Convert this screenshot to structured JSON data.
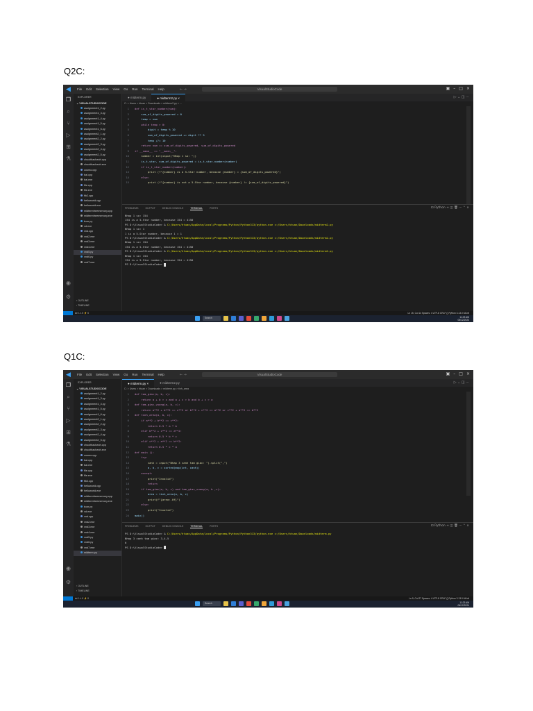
{
  "headings": {
    "q2": "Q2C:",
    "q1": "Q1C:"
  },
  "window": {
    "menus": [
      "File",
      "Edit",
      "Selection",
      "View",
      "Go",
      "Run",
      "Terminal",
      "Help"
    ],
    "search": "VisualStudioCode",
    "explorer_label": "EXPLORER",
    "folder": "VISUALSTUDIOCODE",
    "outline": "OUTLINE",
    "timeline": "TIMELINE",
    "panel_tabs": [
      "PROBLEMS",
      "OUTPUT",
      "DEBUG CONSOLE",
      "TERMINAL",
      "PORTS"
    ],
    "panel_right": "Python",
    "taskbar_search": "Search",
    "accent": "#0078d4"
  },
  "screenshot_q2": {
    "tabs": [
      "midterm.py",
      "midterm2.py"
    ],
    "active_tab": 1,
    "breadcrumb": "C: > Users > htuan > Downloads > midterm2.py > ...",
    "files": [
      "assignment1_2.py",
      "assignment1_3.py",
      "assignment1_4.py",
      "assignment1_5.py",
      "assignment1_6.py",
      "assignment2_1.py",
      "assignment2_2.py",
      "assignment2_3.py",
      "assignment2_4.py",
      "assignment2_5.py",
      "chuoithachanh.cpp",
      "chuoithachanh.exe",
      "cosmo.cpp",
      "bai.cpp",
      "bai.exe",
      "file.cpp",
      "file.exe",
      "fib2.cpp",
      "helloworld.cpp",
      "helloworld.exe",
      "midtermfreememory.cpp",
      "midtermfreememory.exe",
      "tcon.py",
      "vd.exe",
      "vnd.cpp",
      "vnd2.exe",
      "vnd3.exe",
      "vnd4.exe",
      "vnd5.py",
      "vnd6.py",
      "vnd7.exe"
    ],
    "active_file": 28,
    "code": [
      "def is_t_star_number(num):",
      "    sum_of_digits_powered = 0",
      "    temp = num",
      "    while temp > 0:",
      "        digit = temp % 10",
      "        sum_of_digits_powered += digit ** 5",
      "        temp //= 10",
      "    return num == sum_of_digits_powered, sum_of_digits_powered",
      "if __name__ == \"__main__\":",
      "    number = int(input(\"Nhap 1 so: \"))",
      "    is_t_star, sum_of_digits_powered = is_t_star_number(number)",
      "    if is_t_star_number(number):",
      "        print (f\"{number} is a 5-Star number, because {number} = {sum_of_digits_powered}\")",
      "    else:",
      "        print (f\"{number} is not a 5-Star number, because {number} != {sum_of_digits_powered}\")"
    ],
    "line_numbers": [
      "1",
      "2",
      "3",
      "4",
      "5",
      "6",
      "7",
      "8",
      "9",
      "10",
      "11",
      "12",
      "13",
      "14",
      "15"
    ],
    "terminal": [
      "Nhap 1 so: 154",
      "154 is a 5-Star number, because 154 = 4150",
      "PS D:\\VisualStudioCode> & C:/Users/htuan/AppData/Local/Programs/Python/Python313/python.exe c:/Users/htuan/Downloads/midterm2.py",
      "Nhap 1 so: 1",
      "1 is a 5-Star number, because 1 = 1",
      "PS D:\\VisualStudioCode> & C:/Users/htuan/AppData/Local/Programs/Python/Python313/python.exe c:/Users/htuan/Downloads/midterm2.py",
      "Nhap 1 so: 154",
      "154 is a 5-Star number, because 154 = 4150",
      "PS D:\\VisualStudioCode> & C:/Users/htuan/AppData/Local/Programs/Python/Python313/python.exe c:/Users/htuan/Downloads/midterm2.py",
      "Nhap 1 so: 154",
      "154 is a 5-Star number, because 154 = 4150",
      "PS D:\\VisualStudioCode> "
    ],
    "status_left": "⊗ 0 ⚠ 0   ⚡ 0",
    "status_right": "Ln 15, Col 14   Spaces: 4   UTF-8   CRLF   {} Python   3.13.0 64-bit",
    "clock": "11:23 AM",
    "date": "06/12/2024"
  },
  "screenshot_q1": {
    "tabs": [
      "midterm.py",
      "midterm2.py"
    ],
    "active_tab": 0,
    "breadcrumb": "C: > Users > htuan > Downloads > midterm.py > tinh_area",
    "files": [
      "assignment1_2.py",
      "assignment1_3.py",
      "assignment1_4.py",
      "assignment1_5.py",
      "assignment1_6.py",
      "assignment2_1.py",
      "assignment2_2.py",
      "assignment2_3.py",
      "assignment2_4.py",
      "assignment2_5.py",
      "chuoithachanh.cpp",
      "chuoithachanh.exe",
      "cosmo.cpp",
      "bai.cpp",
      "bai.exe",
      "file.cpp",
      "file.exe",
      "fib2.cpp",
      "helloworld.cpp",
      "helloworld.exe",
      "midtermfreememory.cpp",
      "midtermfreememory.exe",
      "tcon.py",
      "vd.exe",
      "vnd.cpp",
      "vnd2.exe",
      "vnd3.exe",
      "vnd4.exe",
      "vnd5.py",
      "vnd6.py",
      "vnd7.exe",
      "midterm.py"
    ],
    "active_file": 31,
    "code": [
      "def tam_giac(a, b, c):",
      "    return a + b > c and a + c > b and b + c > a",
      "def tam_giac_vuong(a, b, c):",
      "    return a**2 + b**2 == c**2 or b**2 + c**2 == a**2 or c**2 + a**2 == b**2",
      "def tinh_area(a, b, c):",
      "    if a**2 + b**2 == c**2:",
      "        return 0.5 * a * b",
      "    elif b**2 + c**2 == a**2:",
      "        return 0.5 * b * c",
      "    elif c**2 + a**2 == b**2:",
      "        return 0.5 * c * a",
      "def main ():",
      "    try:",
      "        canh = input(\"Nhap 3 canh tam giac: \").split(\",\")",
      "        a, b, c = sorted(map(int, canh))",
      "    except:",
      "        print(\"Invalid\")",
      "        return",
      "    if tam_giac(a, b, c) and tam_giac_vuong(a, b ,c):",
      "        area = tinh_area(a, b, c)",
      "        print(f\"{area:.0f}\")",
      "    else:",
      "        print(\"Invalid\")",
      "main()"
    ],
    "line_numbers": [
      "1",
      "2",
      "3",
      "4",
      "5",
      "6",
      "7",
      "8",
      "9",
      "10",
      "11",
      "12",
      "13",
      "14",
      "15",
      "16",
      "17",
      "18",
      "19",
      "20",
      "21",
      "22",
      "23",
      "24"
    ],
    "terminal": [
      "PS D:\\VisualStudioCode> & C:/Users/htuan/AppData/Local/Programs/Python/Python313/python.exe c:/Users/htuan/Downloads/midterm.py",
      "Nhap 3 canh tam giac: 3,4,5",
      "6",
      "PS D:\\VisualStudioCode> "
    ],
    "status_left": "⊗ 0 ⚠ 0   ⚡ 0",
    "status_right": "Ln 9, Col 27   Spaces: 4   UTF-8   CRLF   {} Python   3.13.0 64-bit",
    "clock": "11:23 AM",
    "date": "06/12/2024"
  }
}
